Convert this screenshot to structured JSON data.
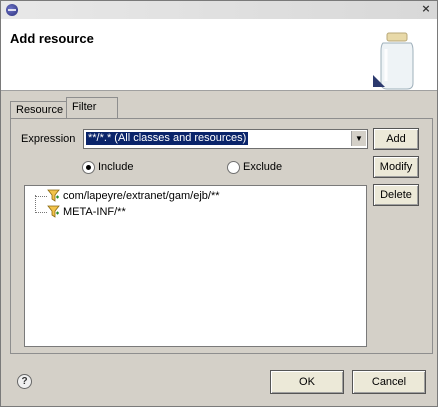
{
  "window": {
    "title": "",
    "close_glyph": "×"
  },
  "header": {
    "title": "Add resource"
  },
  "tabs": [
    {
      "label": "Resource",
      "active": false
    },
    {
      "label": "Filter",
      "active": true
    }
  ],
  "filter": {
    "expression_label": "Expression",
    "expression_value": "**/*.* (All classes and resources)",
    "include_label": "Include",
    "exclude_label": "Exclude",
    "selected_mode": "include",
    "items": [
      "com/lapeyre/extranet/gam/ejb/**",
      "META-INF/**"
    ],
    "add_label": "Add",
    "modify_label": "Modify",
    "delete_label": "Delete"
  },
  "footer": {
    "help_glyph": "?",
    "ok_label": "OK",
    "cancel_label": "Cancel"
  },
  "colors": {
    "selection": "#0a246a",
    "dialog_bg": "#d4d0c8",
    "header_bg": "#ffffff"
  }
}
